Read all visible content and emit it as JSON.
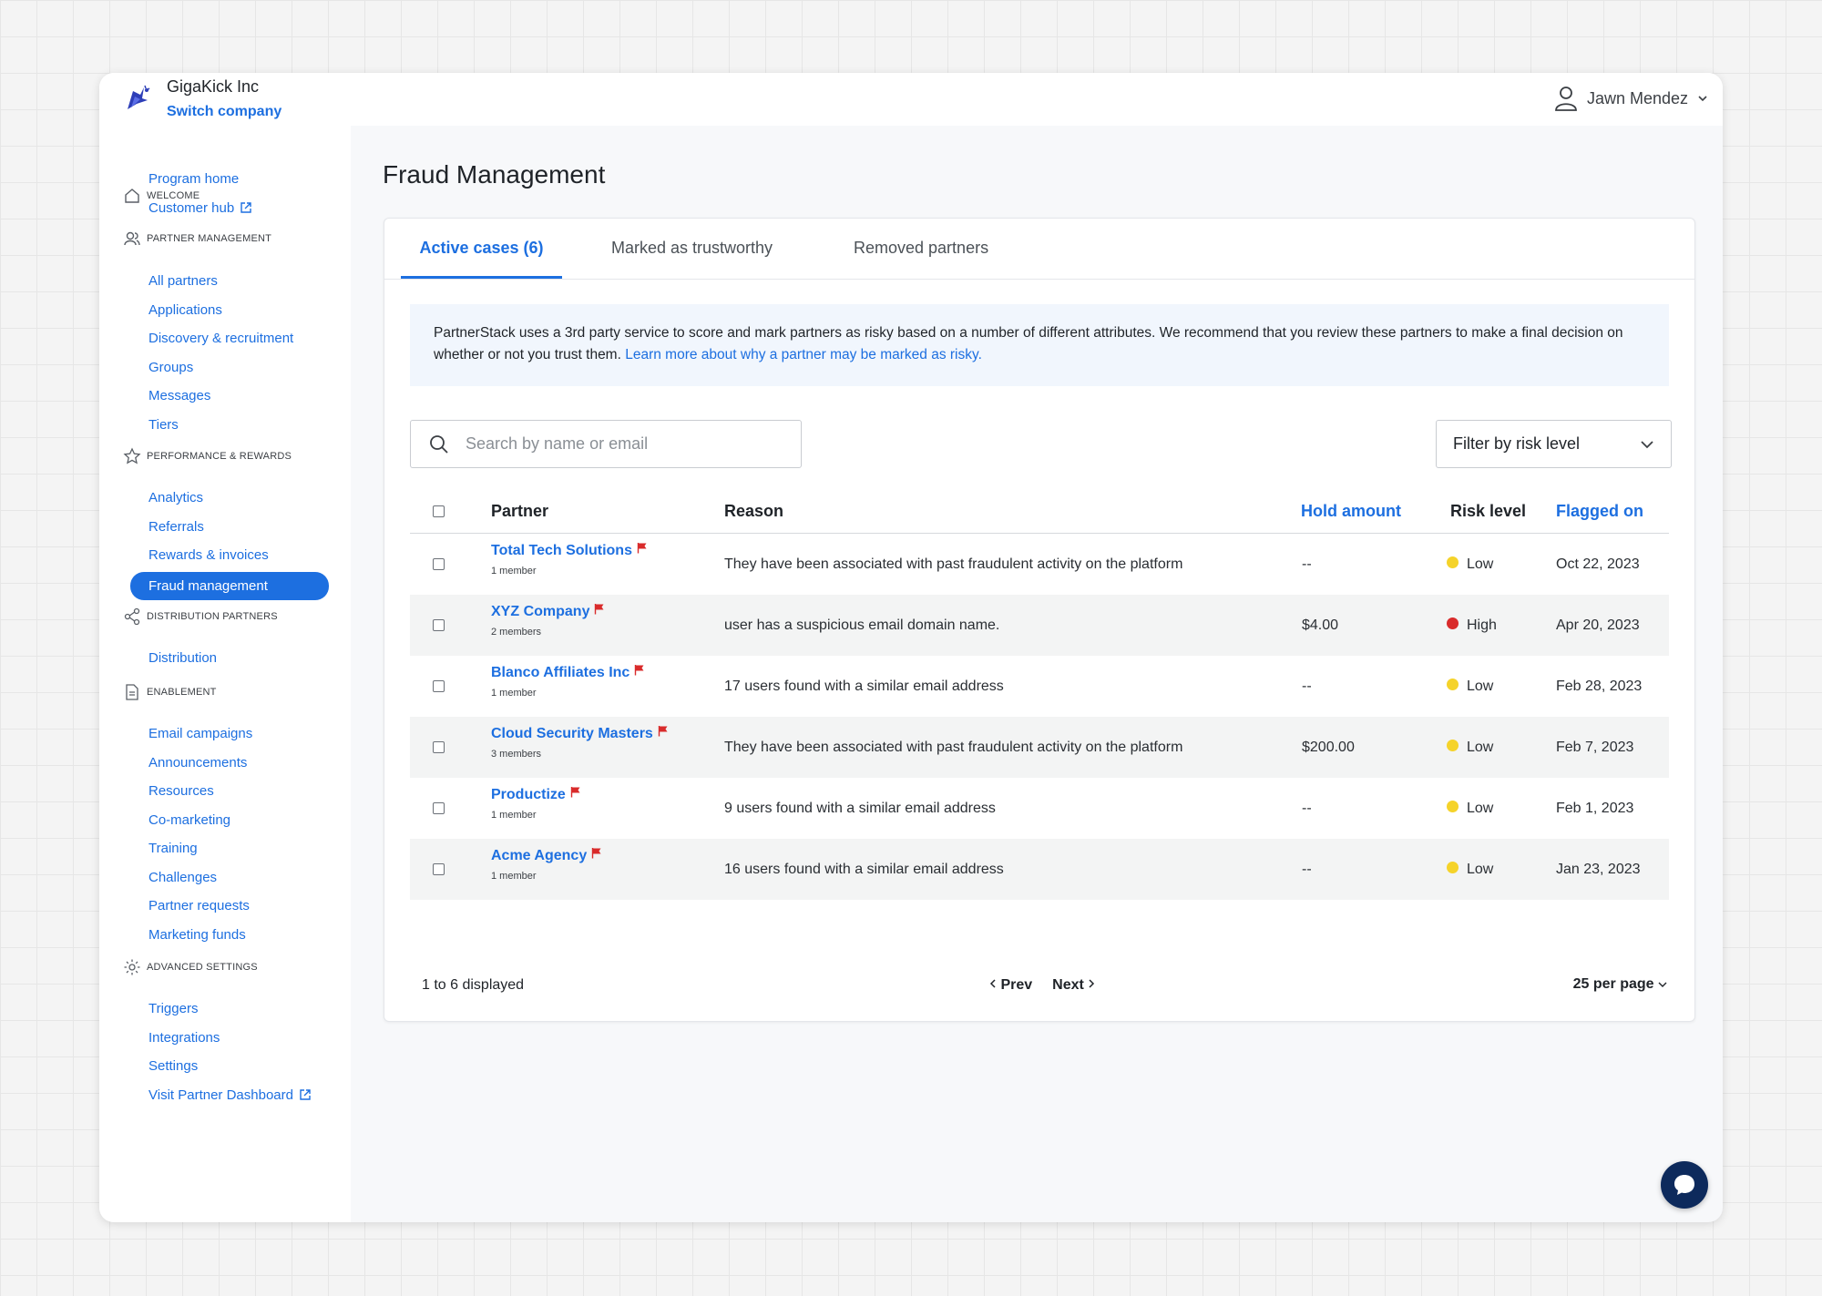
{
  "company": {
    "name": "GigaKick Inc",
    "switch_label": "Switch company"
  },
  "user": {
    "name": "Jawn Mendez"
  },
  "sidebar": {
    "sections": [
      {
        "title": "WELCOME",
        "icon": "home-icon",
        "items": [
          "Program home",
          "Customer hub"
        ]
      },
      {
        "title": "PARTNER MANAGEMENT",
        "icon": "users-icon",
        "items": [
          "All partners",
          "Applications",
          "Discovery & recruitment",
          "Groups",
          "Messages",
          "Tiers"
        ]
      },
      {
        "title": "PERFORMANCE & REWARDS",
        "icon": "star-icon",
        "items": [
          "Analytics",
          "Referrals",
          "Rewards & invoices",
          "Fraud management"
        ]
      },
      {
        "title": "DISTRIBUTION PARTNERS",
        "icon": "share-icon",
        "items": [
          "Distribution"
        ]
      },
      {
        "title": "ENABLEMENT",
        "icon": "document-icon",
        "items": [
          "Email campaigns",
          "Announcements",
          "Resources",
          "Co-marketing",
          "Training",
          "Challenges",
          "Partner requests",
          "Marketing funds"
        ]
      },
      {
        "title": "ADVANCED SETTINGS",
        "icon": "gear-icon",
        "items": [
          "Triggers",
          "Integrations",
          "Settings",
          "Visit Partner Dashboard"
        ]
      }
    ],
    "active_item": "Fraud management"
  },
  "page": {
    "title": "Fraud Management"
  },
  "tabs": [
    "Active cases (6)",
    "Marked as trustworthy",
    "Removed partners"
  ],
  "notice": {
    "text": "PartnerStack uses a 3rd party service to score and mark partners as risky based on a number of different attributes. We recommend that you review these partners to make a final decision on whether or not you trust them.",
    "link": "Learn more about why a partner may be marked as risky."
  },
  "search": {
    "placeholder": "Search by name or email",
    "value": ""
  },
  "filter": {
    "label": "Filter by risk level"
  },
  "table": {
    "columns": [
      "Partner",
      "Reason",
      "Hold amount",
      "Risk level",
      "Flagged on"
    ],
    "rows": [
      {
        "partner": "Total Tech Solutions",
        "members": "1 member",
        "reason": "They have been associated with past fraudulent activity on the platform",
        "hold": "--",
        "risk": "Low",
        "flagged": "Oct 22, 2023"
      },
      {
        "partner": "XYZ Company",
        "members": "2 members",
        "reason": "user has a suspicious email domain name.",
        "hold": "$4.00",
        "risk": "High",
        "flagged": "Apr 20, 2023"
      },
      {
        "partner": "Blanco Affiliates Inc",
        "members": "1 member",
        "reason": "17 users found with a similar email address",
        "hold": "--",
        "risk": "Low",
        "flagged": "Feb 28, 2023"
      },
      {
        "partner": "Cloud Security Masters",
        "members": "3 members",
        "reason": "They have been associated with past fraudulent activity on the platform",
        "hold": "$200.00",
        "risk": "Low",
        "flagged": "Feb 7, 2023"
      },
      {
        "partner": "Productize",
        "members": "1 member",
        "reason": "9 users found with a similar email address",
        "hold": "--",
        "risk": "Low",
        "flagged": "Feb 1, 2023"
      },
      {
        "partner": "Acme Agency",
        "members": "1 member",
        "reason": "16 users found with a similar email address",
        "hold": "--",
        "risk": "Low",
        "flagged": "Jan 23, 2023"
      }
    ]
  },
  "risk_colors": {
    "Low": "#f5d32a",
    "High": "#d92b2b"
  },
  "footer": {
    "count": "1 to 6 displayed",
    "prev": "Prev",
    "next": "Next",
    "per_page": "25 per page"
  },
  "colors": {
    "accent": "#1d6fe0",
    "flag": "#d92b2b",
    "chat": "#0d2a5c"
  }
}
